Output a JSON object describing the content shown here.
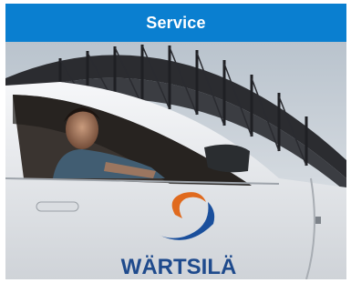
{
  "header": {
    "title": "Service"
  },
  "photo": {
    "logo_text": "WÄRTSILÄ",
    "colors": {
      "header_bg": "#0a7fd0",
      "sky": "#cfd6dd",
      "bridge": "#2a2a2e",
      "car_body": "#eef0f3",
      "logo_blue": "#1a4f9c",
      "logo_orange": "#e06a1e"
    }
  }
}
